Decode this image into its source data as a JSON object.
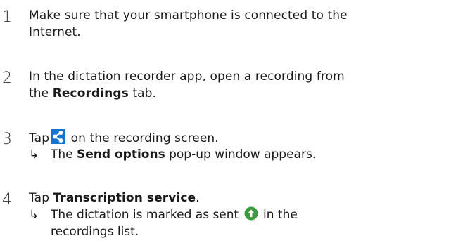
{
  "steps": [
    {
      "number": "1",
      "line1": "Make sure that your smartphone is connected to the",
      "line2": "Internet."
    },
    {
      "number": "2",
      "line1": "In the dictation recorder app, open a recording from",
      "line2_pre": "the ",
      "line2_bold": "Recordings",
      "line2_post": " tab."
    },
    {
      "number": "3",
      "pre": "Tap",
      "post": "on the recording screen.",
      "result_pre": "The ",
      "result_bold": "Send options",
      "result_post": " pop-up window appears."
    },
    {
      "number": "4",
      "pre": "Tap ",
      "bold": "Transcription service",
      "post": ".",
      "result_pre": "The dictation is marked as sent",
      "result_post": "in the",
      "result_line2": "recordings list."
    }
  ],
  "result_arrow": "↳",
  "icons": {
    "share": "share-icon",
    "sent": "sent-upload-icon"
  },
  "colors": {
    "share_bg": "#1474d4",
    "sent_green": "#3c9a3c"
  }
}
